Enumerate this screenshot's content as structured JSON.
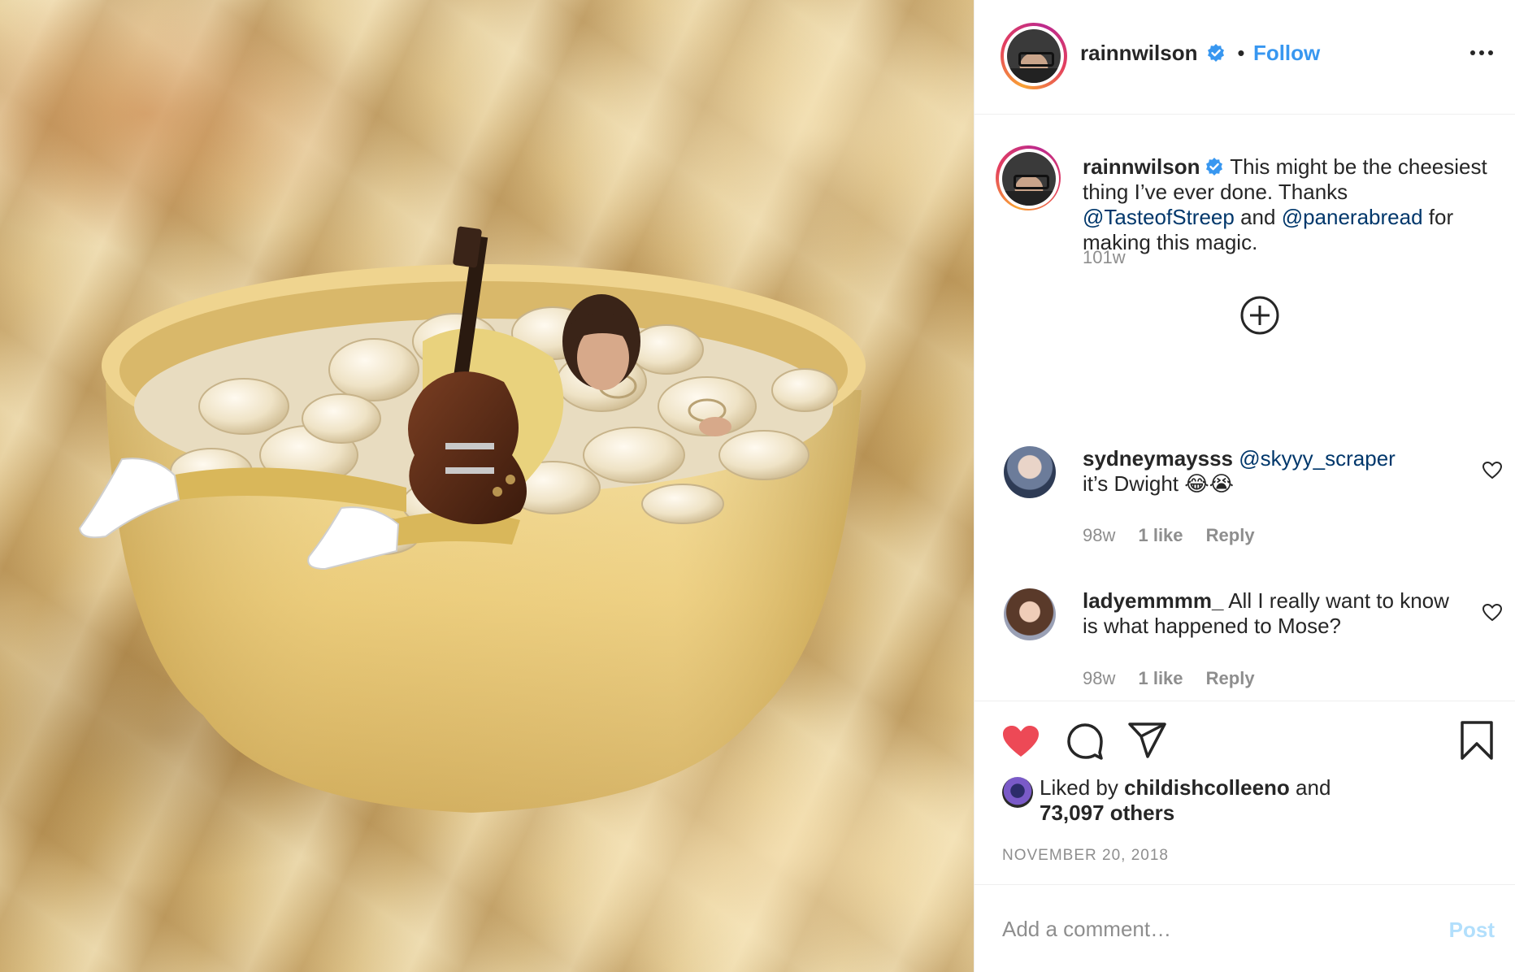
{
  "post": {
    "author": "rainnwilson",
    "follow_separator": "•",
    "follow_label": "Follow",
    "caption_text_1": "This might be the cheesiest thing I’ve ever done. Thanks",
    "caption_mention_1": "@TasteofStreep",
    "caption_and": "and",
    "caption_mention_2": "@panerabread",
    "caption_text_2": "for making this magic.",
    "caption_age": "101w"
  },
  "comments": [
    {
      "user": "sydneymaysss",
      "mention": "@skyyy_scraper",
      "text": "it’s Dwight 😂😭",
      "age": "98w",
      "likes": "1 like",
      "reply_label": "Reply"
    },
    {
      "user": "ladyemmmm_",
      "text": "All I really want to know is what happened to Mose?",
      "age": "98w",
      "likes": "1 like",
      "reply_label": "Reply"
    }
  ],
  "likes": {
    "prefix": "Liked by",
    "user": "childishcolleeno",
    "and": "and",
    "others": "73,097 others"
  },
  "date": "NOVEMBER 20, 2018",
  "composer": {
    "placeholder": "Add a comment…",
    "post_label": "Post"
  },
  "colors": {
    "link": "#3897f0",
    "mention": "#00376b",
    "like_red": "#ed4956",
    "muted": "#8e8e8e",
    "post_disabled": "#b2dffc"
  },
  "icons": [
    "verified-badge-icon",
    "more-options-icon",
    "add-circle-icon",
    "heart-outline-icon",
    "heart-filled-icon",
    "comment-icon",
    "share-icon",
    "bookmark-icon"
  ]
}
